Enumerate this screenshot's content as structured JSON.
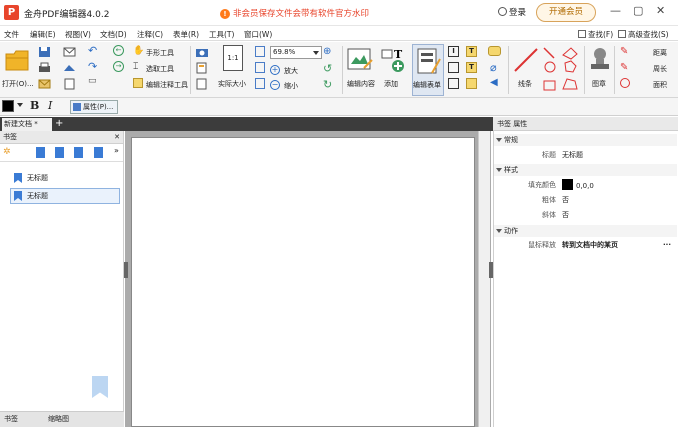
{
  "app": {
    "logo": "P",
    "title": "金舟PDF编辑器4.0.2",
    "promo": "非会员保存文件会带有软件官方水印",
    "login": "登录",
    "vip": "开通会员",
    "window_controls": [
      "—",
      "▢",
      "✕"
    ]
  },
  "menu": {
    "items": [
      "文件",
      "编辑(E)",
      "视图(V)",
      "文档(D)",
      "注释(C)",
      "表单(R)",
      "工具(T)",
      "窗口(W)"
    ],
    "find": "查找(F)",
    "adv_find": "高级查找(S)"
  },
  "toolbar": {
    "open": "打开(O)...",
    "hand_tool": "手形工具",
    "select_tool": "选取工具",
    "edit_annot_tool": "编辑注释工具",
    "actual_size": "实际大小",
    "zoom_value": "69.8%",
    "zoom_in": "放大",
    "zoom_out": "缩小",
    "edit_content": "编辑内容",
    "add": "添加",
    "edit_form": "编辑表单",
    "lines": "线条",
    "stamp": "图章",
    "distance": "距离",
    "perimeter": "周长",
    "area": "面积"
  },
  "format": {
    "bold": "B",
    "italic": "I",
    "properties": "属性(P)..."
  },
  "doc": {
    "tab": "新建文档 *",
    "add_tab": "+"
  },
  "left": {
    "header": "书签",
    "close": "✕",
    "bookmarks": [
      "无标题",
      "无标题"
    ],
    "tabs": [
      "书签",
      "缩略图"
    ]
  },
  "right": {
    "header": "书签 属性",
    "sections": {
      "common": "常规",
      "style": "样式",
      "action": "动作"
    },
    "props": {
      "title_key": "标题",
      "title_val": "无标题",
      "fill_key": "填充颜色",
      "fill_val": "0,0,0",
      "bold_key": "粗体",
      "bold_val": "否",
      "italic_key": "斜体",
      "italic_val": "否",
      "mouse_key": "鼠标释放",
      "mouse_val": "转到文档中的某页",
      "more": "···"
    }
  }
}
